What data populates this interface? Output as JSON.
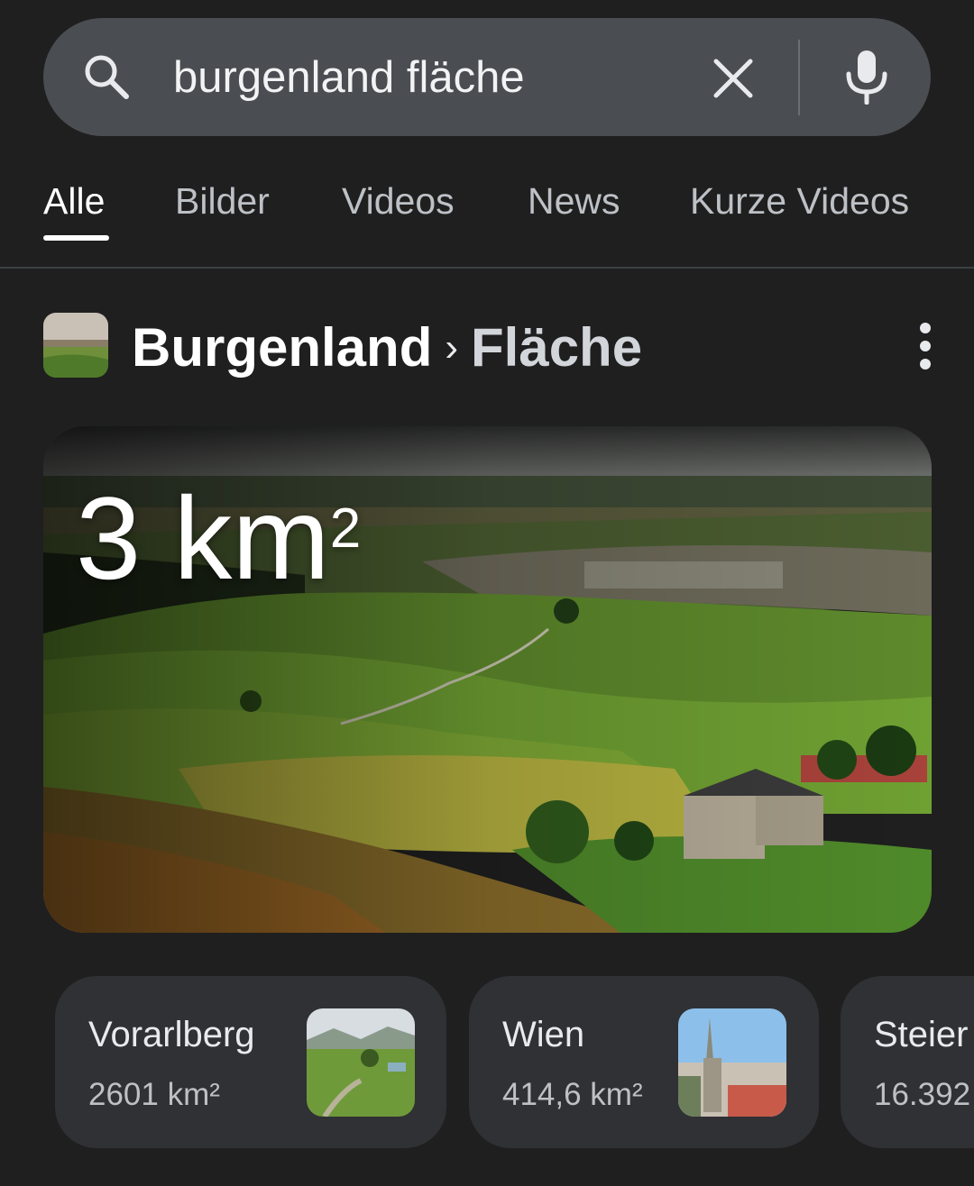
{
  "search": {
    "query": "burgenland fläche"
  },
  "tabs": [
    {
      "label": "Alle",
      "active": true
    },
    {
      "label": "Bilder",
      "active": false
    },
    {
      "label": "Videos",
      "active": false
    },
    {
      "label": "News",
      "active": false
    },
    {
      "label": "Kurze Videos",
      "active": false
    }
  ],
  "result": {
    "entity": "Burgenland",
    "separator": "›",
    "attribute": "Fläche",
    "value": "3 km",
    "value_sup": "2"
  },
  "cards": [
    {
      "name": "Vorarlberg",
      "value": "2601 km²"
    },
    {
      "name": "Wien",
      "value": "414,6 km²"
    },
    {
      "name": "Steier",
      "value": "16.392"
    }
  ],
  "icons": {
    "search": "search-icon",
    "clear": "close-icon",
    "mic": "mic-icon",
    "more": "more-vert-icon"
  }
}
